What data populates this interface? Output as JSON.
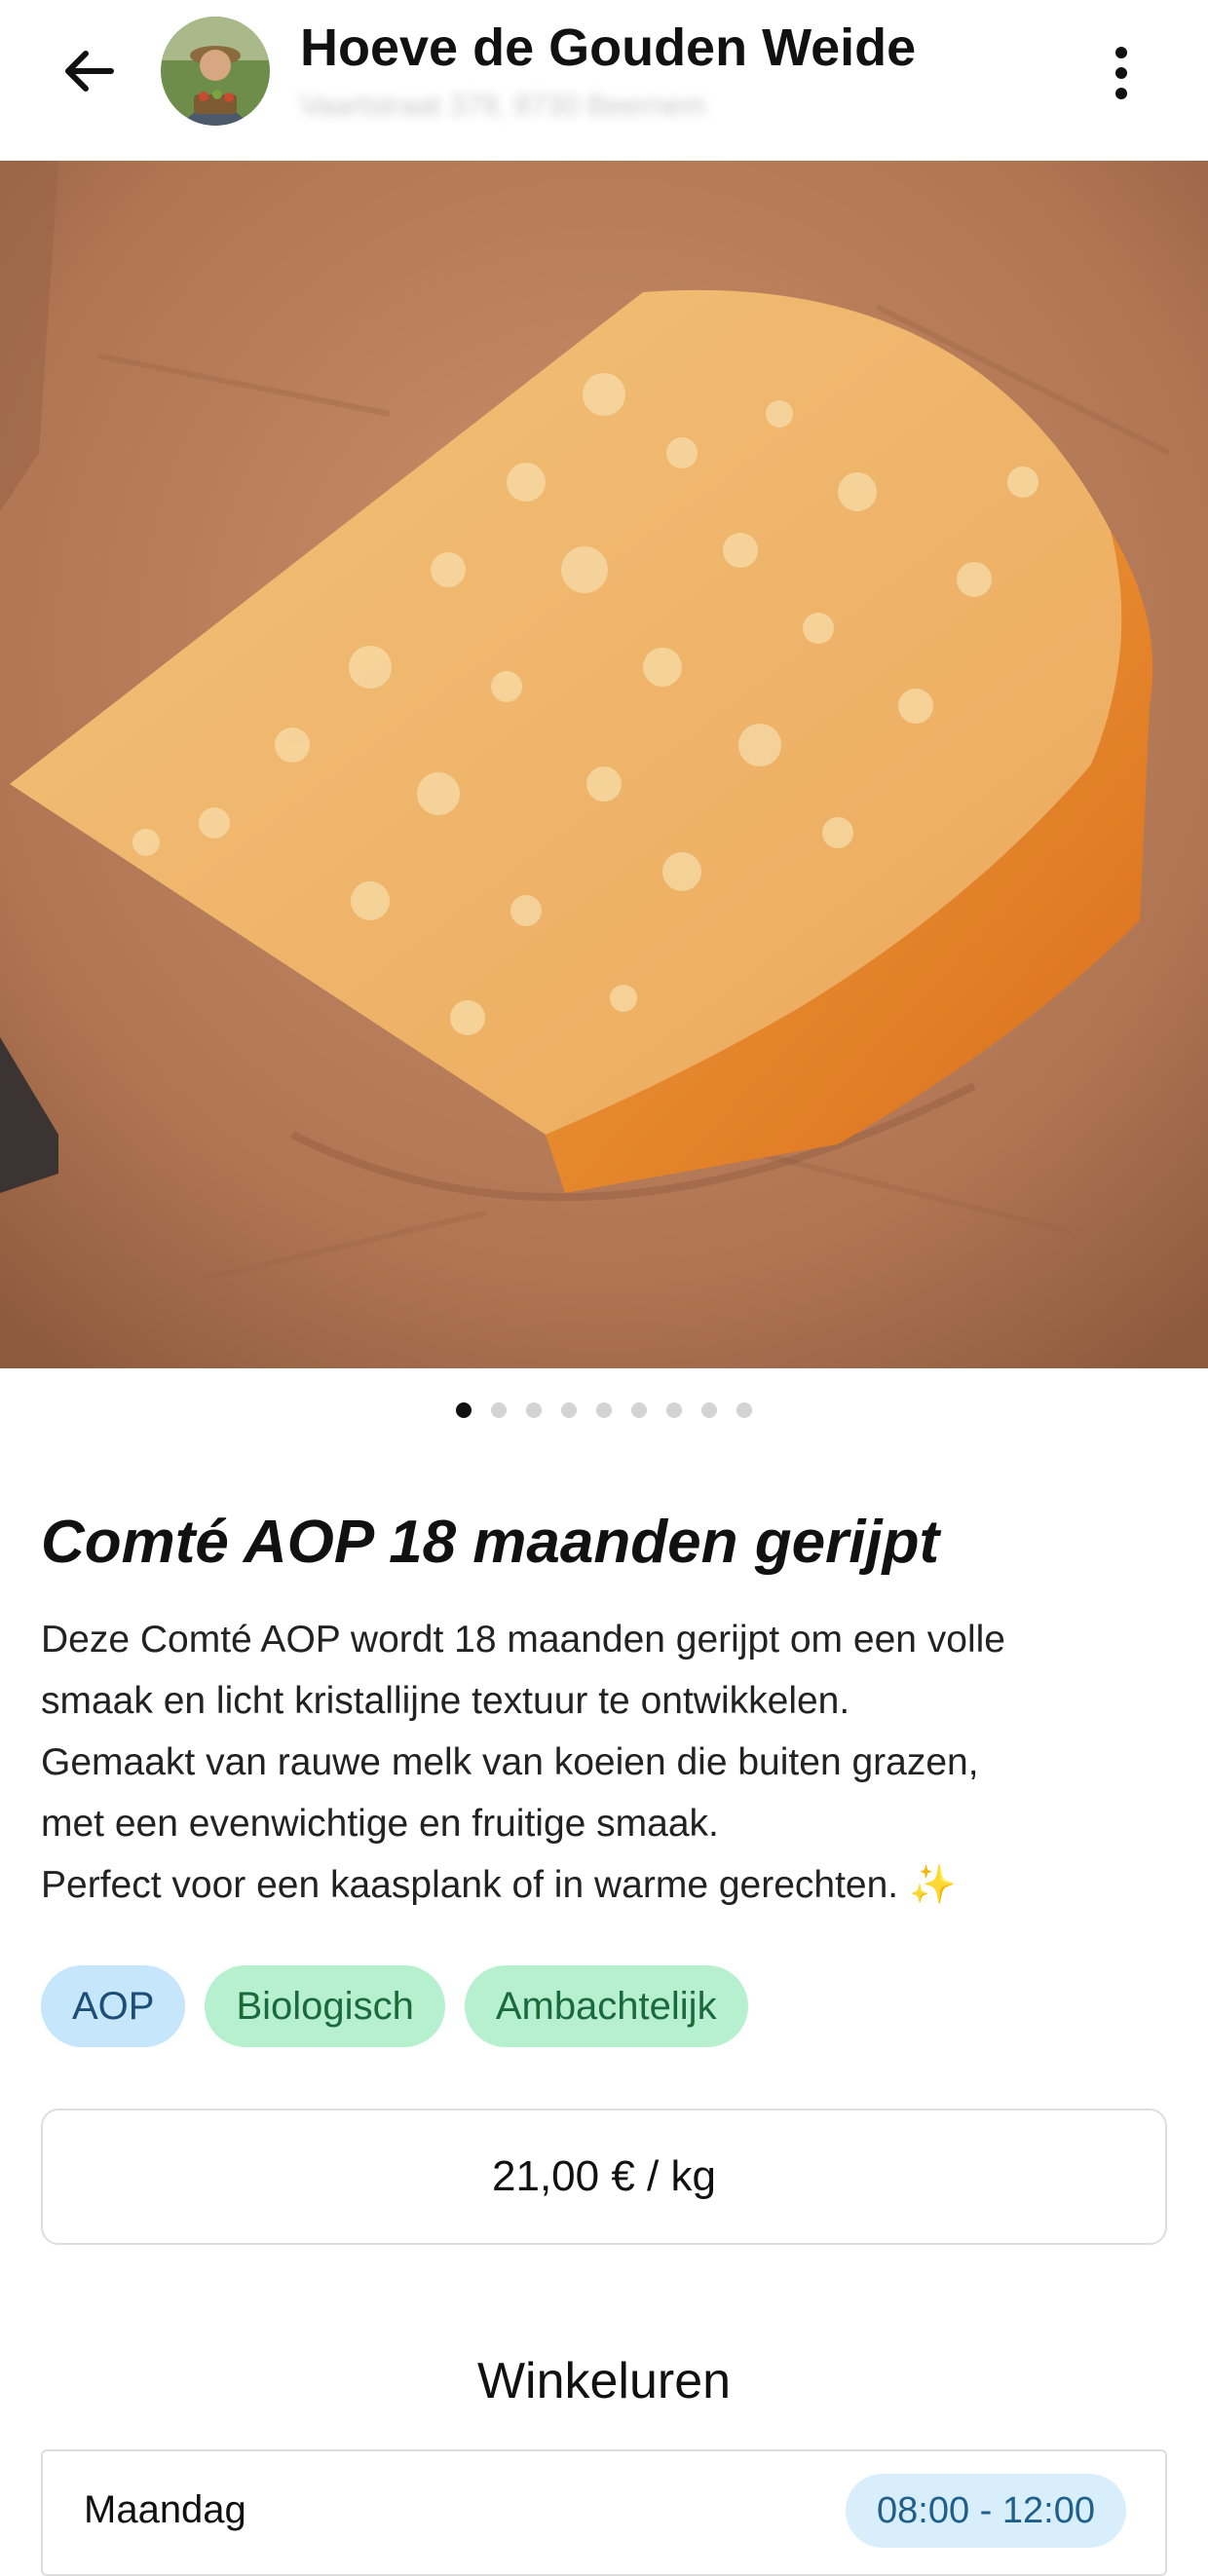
{
  "header": {
    "shop_name": "Hoeve de Gouden Weide",
    "shop_address": "Vaartstraat 379, 8730 Beernem",
    "back_icon": "arrow-left-icon",
    "menu_icon": "more-vertical-icon"
  },
  "carousel": {
    "total_images": 9,
    "active_index": 1
  },
  "product": {
    "title": "Comté AOP 18 maanden gerijpt",
    "description_lines": [
      "Deze Comté AOP wordt 18 maanden gerijpt om een volle",
      "smaak en licht kristallijne textuur te ontwikkelen.",
      "Gemaakt van rauwe melk van koeien die buiten grazen,",
      "met een evenwichtige en fruitige smaak.",
      "Perfect voor een kaasplank of in warme gerechten. ✨"
    ],
    "tags": [
      "AOP",
      "Biologisch",
      "Ambachtelijk"
    ],
    "price": "21,00 € / kg"
  },
  "hours": {
    "title": "Winkeluren",
    "rows": [
      {
        "day": "Maandag",
        "time": "08:00 - 12:00"
      }
    ]
  },
  "colors": {
    "tag_blue": "#c6e6fb",
    "tag_green": "#b7f0cf",
    "time_badge": "#d9eefb"
  }
}
